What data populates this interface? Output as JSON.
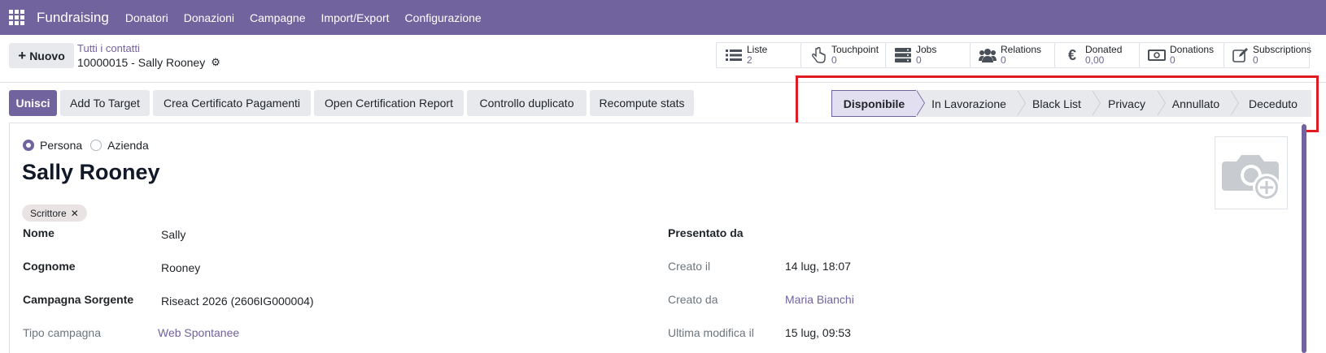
{
  "topnav": {
    "app_name": "Fundraising",
    "menu": [
      "Donatori",
      "Donazioni",
      "Campagne",
      "Import/Export",
      "Configurazione"
    ]
  },
  "control_panel": {
    "new_label": "Nuovo",
    "breadcrumb_parent": "Tutti i contatti",
    "breadcrumb_current": "10000015 - Sally Rooney",
    "smart_buttons": [
      {
        "label": "Liste",
        "value": "2",
        "icon": "list-icon"
      },
      {
        "label": "Touchpoint",
        "value": "0",
        "icon": "hand-pointer-icon"
      },
      {
        "label": "Jobs",
        "value": "0",
        "icon": "server-icon"
      },
      {
        "label": "Relations",
        "value": "0",
        "icon": "users-icon"
      },
      {
        "label": "Donated",
        "value": "0,00",
        "icon": "euro-icon"
      },
      {
        "label": "Donations",
        "value": "0",
        "icon": "money-icon"
      },
      {
        "label": "Subscriptions",
        "value": "0",
        "icon": "edit-icon"
      }
    ]
  },
  "actions": {
    "merge": "Unisci",
    "add_to_target": "Add To Target",
    "create_certificate": "Crea Certificato Pagamenti",
    "open_report": "Open Certification Report",
    "duplicate_check": "Controllo duplicato",
    "recompute": "Recompute stats"
  },
  "stages": [
    "Disponibile",
    "In Lavorazione",
    "Black List",
    "Privacy",
    "Annullato",
    "Deceduto"
  ],
  "active_stage": "Disponibile",
  "form": {
    "type_person": "Persona",
    "type_company": "Azienda",
    "full_name": "Sally Rooney",
    "tag": "Scrittore",
    "left_fields": [
      {
        "label": "Nome",
        "value": "Sally"
      },
      {
        "label": "Cognome",
        "value": "Rooney"
      },
      {
        "label": "Campagna Sorgente",
        "value": "Riseact 2026 (2606IG000004)"
      },
      {
        "label": "Tipo campagna",
        "value": "Web Spontanee"
      }
    ],
    "right_fields": [
      {
        "label": "Presentato da",
        "value": ""
      },
      {
        "label": "Creato il",
        "value": "14 lug, 18:07"
      },
      {
        "label": "Creato da",
        "value": "Maria Bianchi"
      },
      {
        "label": "Ultima modifica il",
        "value": "15 lug, 09:53"
      }
    ]
  },
  "colors": {
    "brand": "#71639e",
    "highlight": "#e11b22"
  }
}
